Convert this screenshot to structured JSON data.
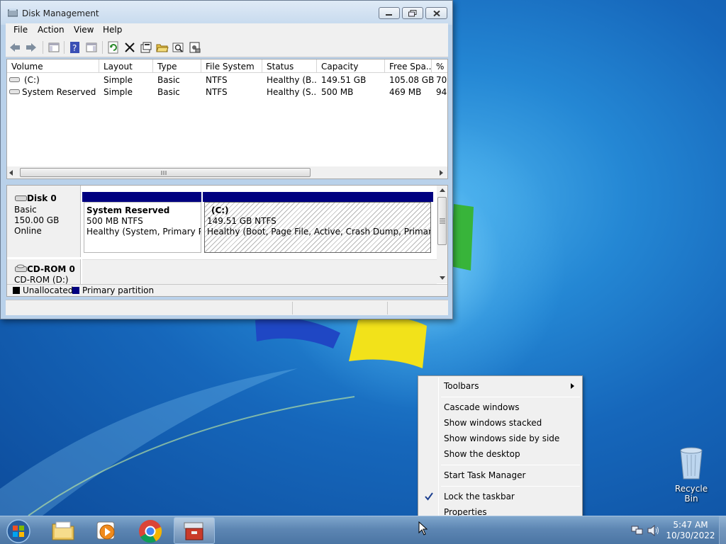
{
  "window": {
    "title": "Disk Management",
    "menus": [
      "File",
      "Action",
      "View",
      "Help"
    ]
  },
  "volumes": {
    "columns": [
      "Volume",
      "Layout",
      "Type",
      "File System",
      "Status",
      "Capacity",
      "Free Spa...",
      "% F"
    ],
    "rows": [
      [
        "(C:)",
        "Simple",
        "Basic",
        "NTFS",
        "Healthy (B...",
        "149.51 GB",
        "105.08 GB",
        "70"
      ],
      [
        "System Reserved",
        "Simple",
        "Basic",
        "NTFS",
        "Healthy (S...",
        "500 MB",
        "469 MB",
        "94"
      ]
    ]
  },
  "disks": {
    "disk0": {
      "name": "Disk 0",
      "kind": "Basic",
      "size": "150.00 GB",
      "state": "Online",
      "partitions": [
        {
          "name": "System Reserved",
          "size": "500 MB NTFS",
          "status": "Healthy (System, Primary Par"
        },
        {
          "name": "(C:)",
          "size": "149.51 GB NTFS",
          "status": "Healthy (Boot, Page File, Active, Crash Dump, Primary Parti"
        }
      ]
    },
    "cdrom0": {
      "name": "CD-ROM 0",
      "label": "CD-ROM (D:)"
    }
  },
  "legend": {
    "unallocated": "Unallocated",
    "primary": "Primary partition",
    "colors": {
      "unallocated": "#000000",
      "primary": "#000080"
    }
  },
  "context_menu": {
    "toolbars": "Toolbars",
    "cascade": "Cascade windows",
    "stacked": "Show windows stacked",
    "side_by_side": "Show windows side by side",
    "show_desktop": "Show the desktop",
    "task_manager": "Start Task Manager",
    "lock_taskbar": "Lock the taskbar",
    "lock_taskbar_checked": true,
    "properties": "Properties"
  },
  "desktop": {
    "recycle_bin": "Recycle Bin"
  },
  "taskbar": {
    "apps": [
      "start-icon",
      "file-explorer-icon",
      "media-player-icon",
      "chrome-icon",
      "computer-management-icon"
    ],
    "time": "5:47 AM",
    "date": "10/30/2022"
  }
}
